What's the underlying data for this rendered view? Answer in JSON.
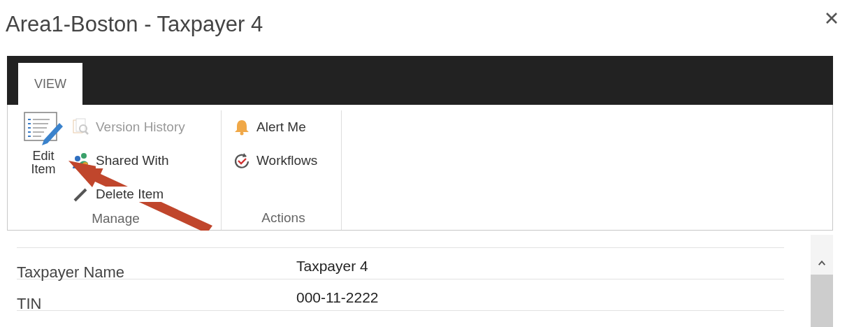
{
  "window": {
    "title": "Area1-Boston - Taxpayer 4"
  },
  "ribbon": {
    "tabs": [
      {
        "label": "VIEW",
        "selected": true
      }
    ],
    "groups": [
      {
        "label": "Manage",
        "buttons": [
          {
            "kind": "large",
            "label": "Edit Item",
            "disabled": false
          },
          {
            "kind": "small",
            "label": "Version History",
            "disabled": true
          },
          {
            "kind": "small",
            "label": "Shared With",
            "disabled": false
          },
          {
            "kind": "small",
            "label": "Delete Item",
            "disabled": false
          }
        ]
      },
      {
        "label": "Actions",
        "buttons": [
          {
            "kind": "small",
            "label": "Alert Me",
            "disabled": false
          },
          {
            "kind": "small",
            "label": "Workflows",
            "disabled": false
          }
        ]
      }
    ]
  },
  "form": {
    "fields": [
      {
        "label": "Taxpayer Name",
        "value": "Taxpayer 4"
      },
      {
        "label": "TIN",
        "value": "000-11-2222"
      }
    ]
  }
}
